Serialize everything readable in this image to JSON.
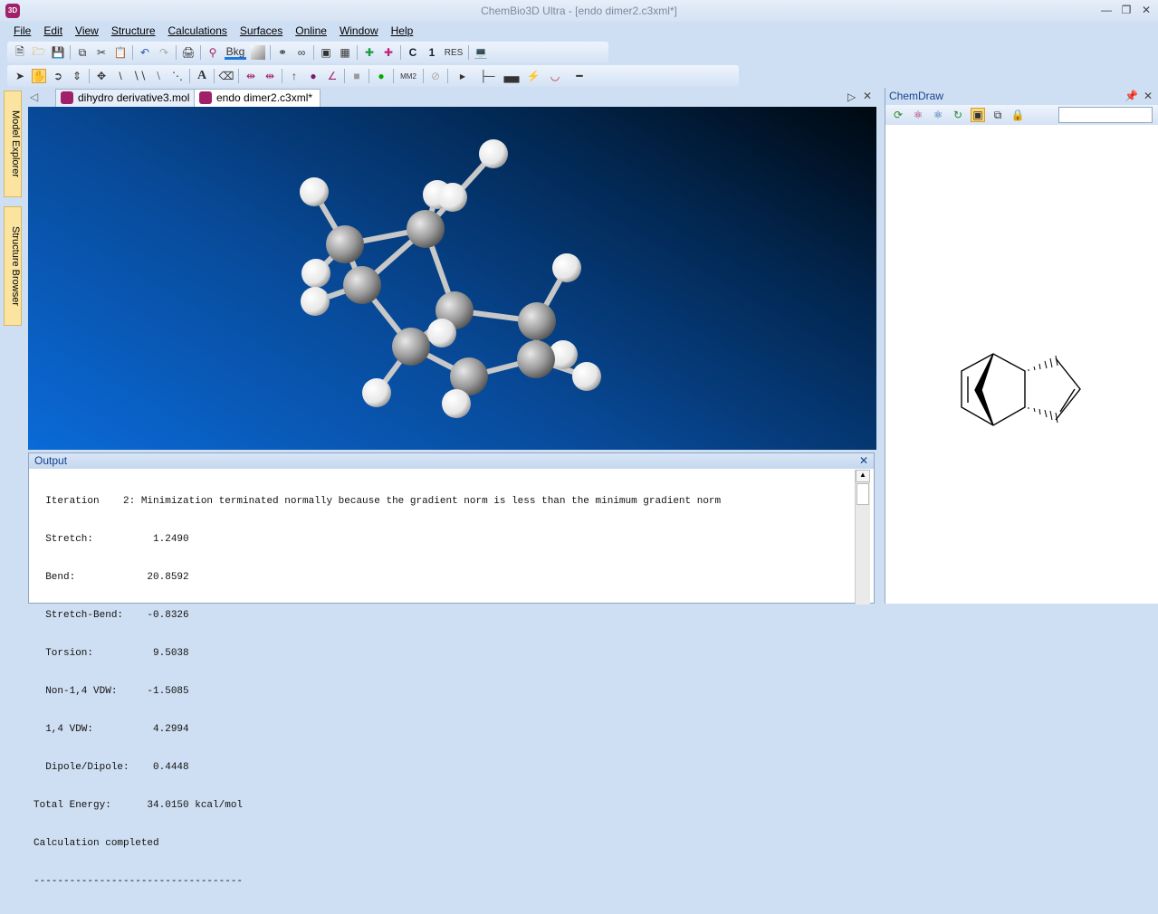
{
  "window": {
    "title": "ChemBio3D Ultra - [endo dimer2.c3xml*]",
    "app_icon": "3D"
  },
  "menu": [
    "File",
    "Edit",
    "View",
    "Structure",
    "Calculations",
    "Surfaces",
    "Online",
    "Window",
    "Help"
  ],
  "toolbar": {
    "bkg_label": "Bkg",
    "c_label": "C",
    "one_label": "1",
    "res_label": "RES",
    "mm2_label": "MM2",
    "text_tool": "A"
  },
  "side_tabs": [
    "Model Explorer",
    "Structure Browser"
  ],
  "tabs": [
    {
      "label": "dihydro derivative3.mol"
    },
    {
      "label": "endo dimer2.c3xml*"
    }
  ],
  "output": {
    "title": "Output",
    "lines": [
      "  Iteration    2: Minimization terminated normally because the gradient norm is less than the minimum gradient norm",
      "  Stretch:          1.2490",
      "  Bend:            20.8592",
      "  Stretch-Bend:    -0.8326",
      "  Torsion:          9.5038",
      "  Non-1,4 VDW:     -1.5085",
      "  1,4 VDW:          4.2994",
      "  Dipole/Dipole:    0.4448",
      "Total Energy:      34.0150 kcal/mol",
      "Calculation completed",
      "-----------------------------------"
    ]
  },
  "chemdraw": {
    "title": "ChemDraw",
    "search_value": ""
  },
  "colors": {
    "accent": "#15428b",
    "app": "#a0206a"
  }
}
